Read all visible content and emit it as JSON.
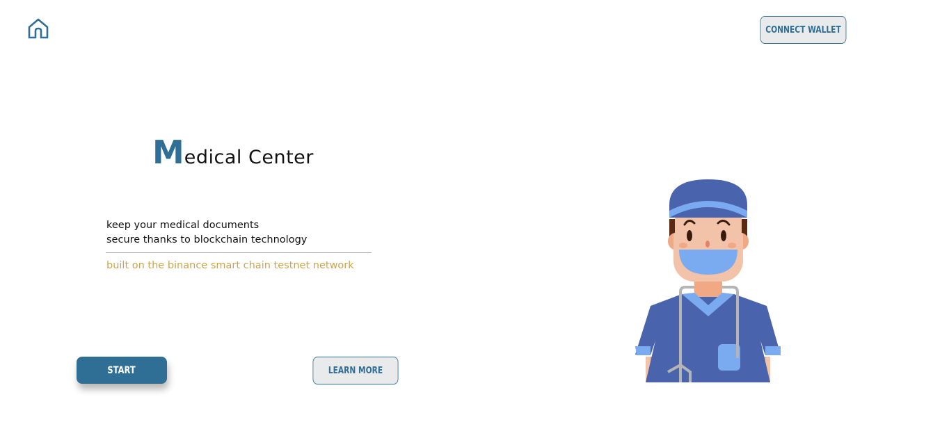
{
  "header": {
    "home_icon": "home-icon",
    "connect_wallet_label": "CONNECT WALLET"
  },
  "hero": {
    "title_initial": "M",
    "title_rest": "edical Center",
    "description_line1": "keep your medical documents",
    "description_line2": "secure thanks to blockchain technology",
    "network_note": "built on the binance smart chain testnet network",
    "illustration": "doctor-illustration"
  },
  "actions": {
    "start_label": "START",
    "learn_more_label": "LEARN MORE"
  },
  "colors": {
    "accent": "#2f6e95",
    "gold": "#c9a44f",
    "button_bg": "#e9eaec",
    "scrubs": "#4a63ad",
    "scrubs_light": "#7aaaf0"
  }
}
